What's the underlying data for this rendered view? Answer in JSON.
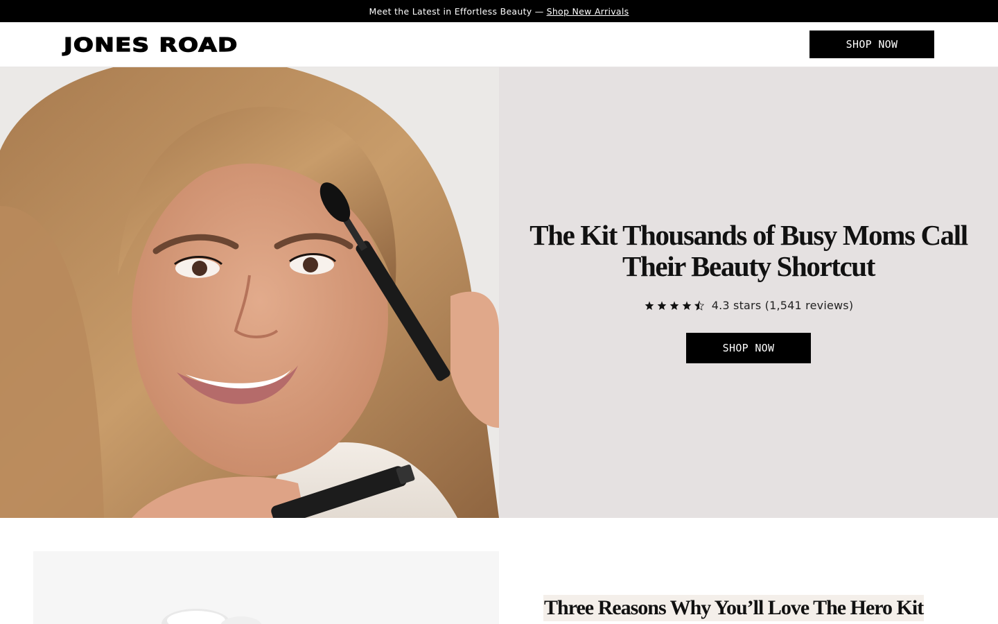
{
  "announcement": {
    "text": "Meet the Latest in Effortless Beauty —",
    "link_text": "Shop New Arrivals"
  },
  "header": {
    "logo": "JONES ROAD",
    "cta_label": "SHOP NOW"
  },
  "hero": {
    "image_alt": "woman-applying-mascara",
    "title": "The Kit Thousands of Busy Moms Call Their Beauty Shortcut",
    "rating": {
      "value": 4.3,
      "max": 5,
      "text": "4.3 stars (1,541 reviews)"
    },
    "cta_label": "SHOP NOW"
  },
  "reasons": {
    "title": "Three Reasons Why You’ll Love The Hero Kit"
  },
  "colors": {
    "black": "#000000",
    "hero_panel_bg": "#e5e1e1",
    "title_highlight": "#f4efea"
  },
  "icons": [
    "star-icon",
    "half-star-icon"
  ]
}
